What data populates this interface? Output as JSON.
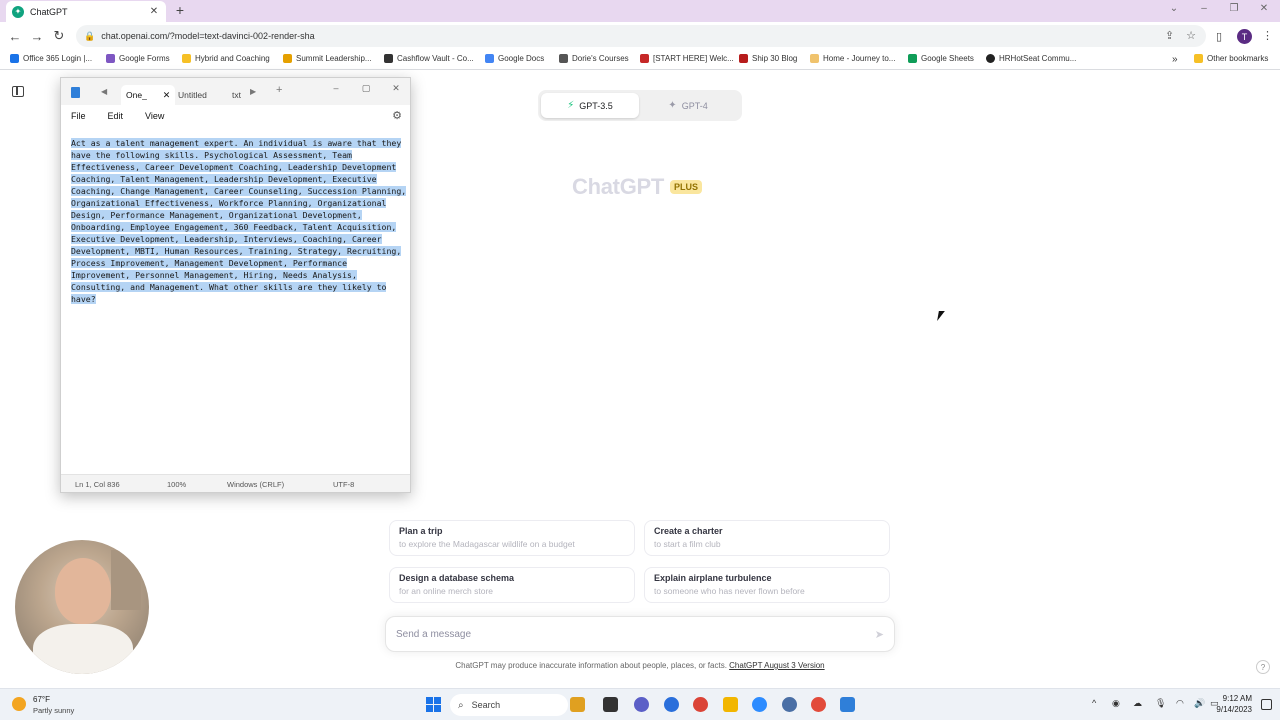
{
  "browser": {
    "tab_title": "ChatGPT",
    "url": "chat.openai.com/?model=text-davinci-002-render-sha",
    "profile_initial": "T",
    "bookmarks": [
      {
        "label": "Office 365 Login |...",
        "color": "#1a73e8"
      },
      {
        "label": "Google Forms",
        "color": "#7e57c2"
      },
      {
        "label": "Hybrid and Coaching",
        "color": "#f6c026"
      },
      {
        "label": "Summit Leadership...",
        "color": "#e5a000"
      },
      {
        "label": "Cashflow Vault - Co...",
        "color": "#333333"
      },
      {
        "label": "Google Docs",
        "color": "#4285f4"
      },
      {
        "label": "Dorie's Courses",
        "color": "#555555"
      },
      {
        "label": "[START HERE] Welc...",
        "color": "#c62828"
      },
      {
        "label": "Ship 30 Blog",
        "color": "#b71c1c"
      },
      {
        "label": "Home - Journey to...",
        "color": "#f0c36d"
      },
      {
        "label": "Google Sheets",
        "color": "#0f9d58"
      },
      {
        "label": "HRHotSeat Commu...",
        "color": "#222222"
      }
    ],
    "other_bookmarks": "Other bookmarks"
  },
  "chatgpt": {
    "models": [
      {
        "label": "GPT-3.5",
        "active": true
      },
      {
        "label": "GPT-4",
        "active": false
      }
    ],
    "logo_text": "ChatGPT",
    "plus_badge": "PLUS",
    "suggestions": [
      {
        "title": "Plan a trip",
        "subtitle": "to explore the Madagascar wildlife on a budget"
      },
      {
        "title": "Create a charter",
        "subtitle": "to start a film club"
      },
      {
        "title": "Design a database schema",
        "subtitle": "for an online merch store"
      },
      {
        "title": "Explain airplane turbulence",
        "subtitle": "to someone who has never flown before"
      }
    ],
    "composer_placeholder": "Send a message",
    "disclaimer": "ChatGPT may produce inaccurate information about people, places, or facts.",
    "version_link": "ChatGPT August 3 Version",
    "help": "?"
  },
  "notepad": {
    "tabs": [
      {
        "label": "One_",
        "active": true
      },
      {
        "label": "Untitled",
        "active": false
      },
      {
        "label": "txt",
        "active": false
      }
    ],
    "menu": [
      "File",
      "Edit",
      "View"
    ],
    "content": "Act as a talent management expert. An individual is aware that they have the following skills. Psychological Assessment, Team Effectiveness, Career Development Coaching, Leadership Development Coaching, Talent Management, Leadership Development, Executive Coaching, Change Management, Career Counseling, Succession Planning, Organizational Effectiveness, Workforce Planning, Organizational Design, Performance Management, Organizational Development, Onboarding, Employee Engagement, 360 Feedback, Talent Acquisition, Executive Development, Leadership, Interviews, Coaching, Career Development, MBTI, Human Resources, Training, Strategy, Recruiting, Process Improvement, Management Development, Performance Improvement, Personnel Management, Hiring, Needs Analysis, Consulting, and Management. What other skills are they likely to have?",
    "status": {
      "position": "Ln 1, Col 836",
      "zoom": "100%",
      "line_ending": "Windows (CRLF)",
      "encoding": "UTF-8"
    }
  },
  "taskbar": {
    "weather_temp": "67°F",
    "weather_desc": "Partly sunny",
    "search_label": "Search",
    "time": "9:12 AM",
    "date": "9/14/2023",
    "apps": [
      {
        "name": "briefcase",
        "color": "#e0a020"
      },
      {
        "name": "files",
        "color": "#333333"
      },
      {
        "name": "teams",
        "color": "#5b5fc7"
      },
      {
        "name": "edge",
        "color": "#2a6fdb"
      },
      {
        "name": "chrome",
        "color": "#db4437"
      },
      {
        "name": "explorer",
        "color": "#f2b600"
      },
      {
        "name": "zoom",
        "color": "#2d8cff"
      },
      {
        "name": "settings",
        "color": "#4a6fa5"
      },
      {
        "name": "chrome-profile",
        "color": "#e24b3b"
      },
      {
        "name": "notepad",
        "color": "#2f7fd9"
      }
    ]
  }
}
